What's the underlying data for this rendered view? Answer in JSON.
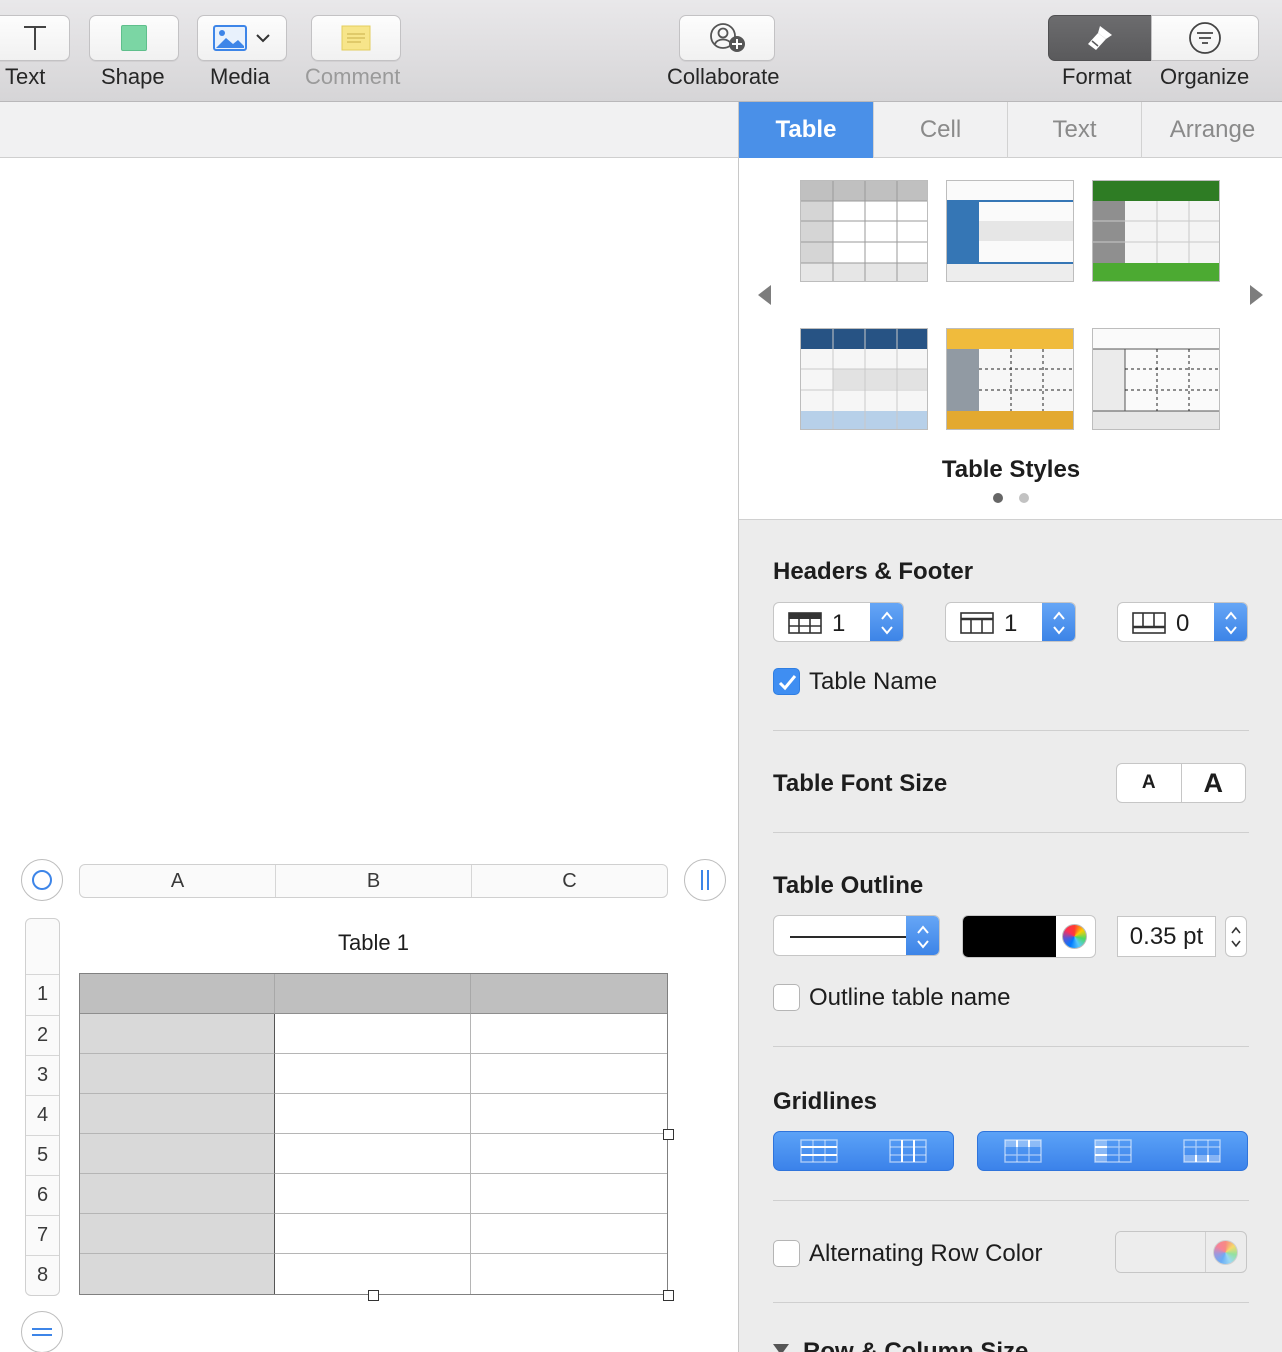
{
  "toolbar": {
    "text_label": "Text",
    "shape_label": "Shape",
    "media_label": "Media",
    "comment_label": "Comment",
    "collaborate_label": "Collaborate",
    "format_label": "Format",
    "organize_label": "Organize",
    "shape_color": "#7bd6a4",
    "comment_color": "#f7e58a"
  },
  "inspector": {
    "tabs": [
      "Table",
      "Cell",
      "Text",
      "Arrange"
    ],
    "active_tab": "Table",
    "styles_caption": "Table Styles",
    "headers_footer": {
      "title": "Headers & Footer",
      "header_rows": "1",
      "header_columns": "1",
      "footer_rows": "0"
    },
    "table_name_label": "Table Name",
    "table_name_checked": true,
    "font_size": {
      "title": "Table Font Size",
      "smaller": "A",
      "larger": "A"
    },
    "outline": {
      "title": "Table Outline",
      "color": "#000000",
      "width": "0.35 pt",
      "outline_name_label": "Outline table name"
    },
    "gridlines_title": "Gridlines",
    "alternating": {
      "label": "Alternating Row Color"
    },
    "row_col_size_title": "Row & Column Size"
  },
  "table": {
    "title": "Table 1",
    "columns": [
      "A",
      "B",
      "C"
    ],
    "rows": [
      "1",
      "2",
      "3",
      "4",
      "5",
      "6",
      "7",
      "8"
    ],
    "header_color": "#bfbfbf",
    "first_col_color": "#d9d9d9"
  },
  "colors": {
    "accent": "#4a90e8"
  }
}
